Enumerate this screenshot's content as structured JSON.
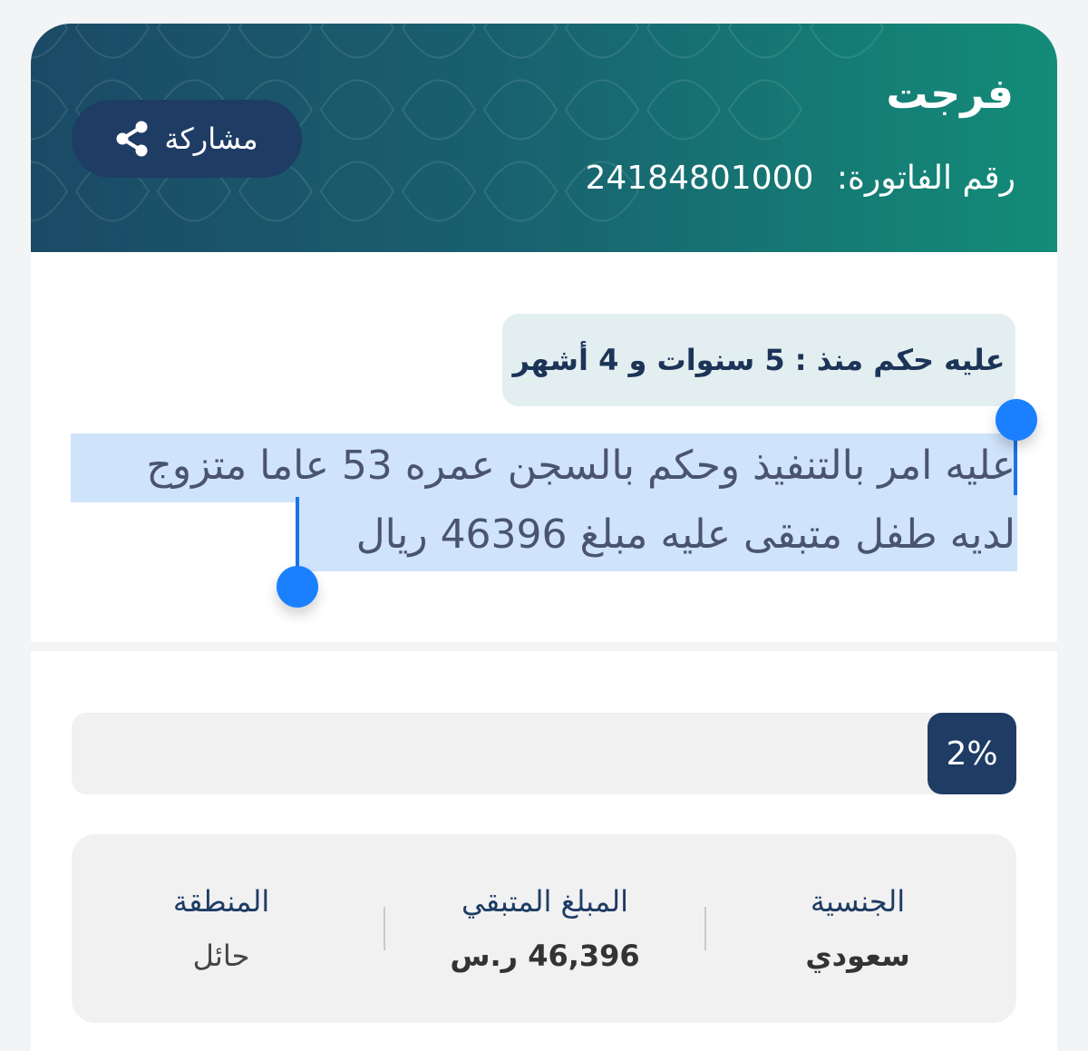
{
  "header": {
    "title": "فرجت",
    "invoice_label": "رقم الفاتورة:",
    "invoice_number": "24184801000",
    "share_label": "مشاركة"
  },
  "case": {
    "duration_badge": "عليه حكم منذ : 5 سنوات و 4 أشهر",
    "description_line1": "عليه امر بالتنفيذ وحكم بالسجن عمره 53 عاما متزوج",
    "description_line2": "لديه طفل متبقى عليه مبلغ 46396 ريال"
  },
  "progress": {
    "percent": 2,
    "label": "2%"
  },
  "info": {
    "nationality_label": "الجنسية",
    "nationality_value": "سعودي",
    "remaining_label": "المبلغ المتبقي",
    "remaining_value": "46,396 ر.س",
    "region_label": "المنطقة",
    "region_value": "حائل"
  },
  "colors": {
    "header_start": "#1b4a66",
    "header_end": "#138c78",
    "navy": "#1e3c64",
    "selection": "#cfe3fb",
    "handle": "#1a80ff"
  },
  "icons": {
    "share": "share-icon"
  }
}
